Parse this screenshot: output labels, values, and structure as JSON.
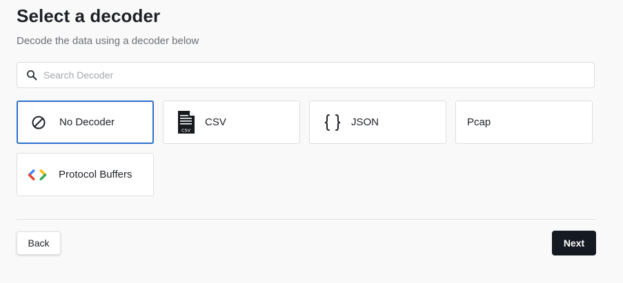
{
  "header": {
    "title": "Select a decoder",
    "subtitle": "Decode the data using a decoder below"
  },
  "search": {
    "placeholder": "Search Decoder",
    "value": "",
    "icon": "search-icon"
  },
  "decoders": [
    {
      "label": "No Decoder",
      "icon": "no-decoder-icon",
      "selected": true
    },
    {
      "label": "CSV",
      "icon": "csv-file-icon",
      "selected": false
    },
    {
      "label": "JSON",
      "icon": "json-braces-icon",
      "selected": false
    },
    {
      "label": "Pcap",
      "icon": "",
      "selected": false
    },
    {
      "label": "Protocol Buffers",
      "icon": "protocol-buffers-icon",
      "selected": false
    }
  ],
  "footer": {
    "back_label": "Back",
    "next_label": "Next"
  },
  "colors": {
    "selected_border": "#2a6fcc",
    "next_button_bg": "#141922",
    "protobuf_blue": "#4285f4",
    "protobuf_red": "#ea4335",
    "protobuf_yellow": "#fbbc04",
    "protobuf_green": "#34a853"
  }
}
